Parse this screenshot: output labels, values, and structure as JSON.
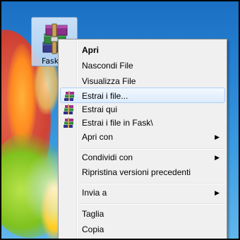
{
  "desktop": {
    "selected_file": {
      "label": "Fask\\",
      "icon": "winrar-archive-icon"
    }
  },
  "context_menu": {
    "items": [
      {
        "label": "Apri",
        "bold": true
      },
      {
        "label": "Nascondi File"
      },
      {
        "label": "Visualizza File"
      },
      {
        "label": "Estrai i file...",
        "icon": "winrar-icon",
        "highlighted": true
      },
      {
        "label": "Estrai qui",
        "icon": "winrar-icon"
      },
      {
        "label": "Estrai i file in Fask\\",
        "icon": "winrar-icon"
      },
      {
        "label": "Apri con",
        "submenu": "submenu-arrow-icon"
      },
      {
        "label": "Condividi con",
        "submenu": "submenu-arrow-icon"
      },
      {
        "label": "Ripristina versioni precedenti"
      },
      {
        "label": "Invia a",
        "submenu": "submenu-arrow-icon"
      },
      {
        "label": "Taglia"
      },
      {
        "label": "Copia"
      }
    ],
    "submenu_arrow_glyph": "▶"
  },
  "colors": {
    "menu_background": "#f0f0f0",
    "menu_border": "#979797",
    "highlight_border": "#aecff7",
    "selection_fill": "#c1dbf5"
  }
}
